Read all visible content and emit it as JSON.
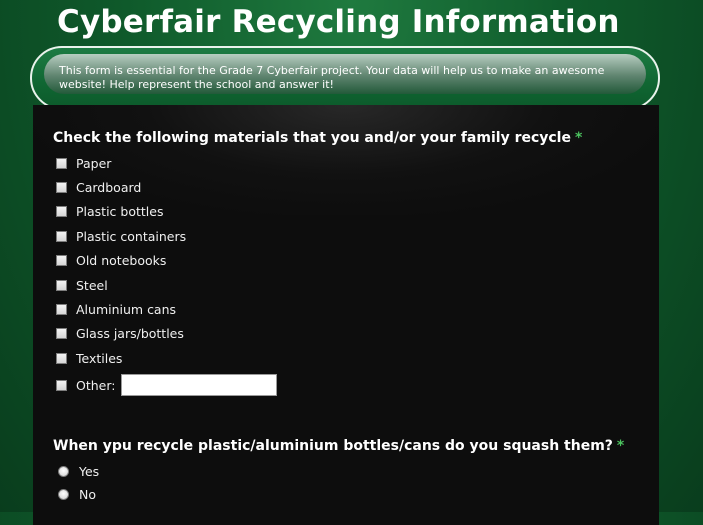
{
  "header": {
    "title": "Cyberfair Recycling Information",
    "description": "This form is essential for the Grade 7 Cyberfair project. Your data will help us to make an awesome website! Help represent the school and answer it!"
  },
  "question1": {
    "label": "Check the following materials that you and/or your family recycle",
    "required_mark": "*",
    "options": [
      "Paper",
      "Cardboard",
      "Plastic bottles",
      "Plastic containers",
      "Old notebooks",
      "Steel",
      "Aluminium cans",
      "Glass jars/bottles",
      "Textiles"
    ],
    "other_label": "Other:",
    "other_value": ""
  },
  "question2": {
    "label": "When ypu recycle plastic/aluminium bottles/cans do you squash them?",
    "required_mark": "*",
    "options": [
      "Yes",
      "No"
    ]
  },
  "colors": {
    "background_green": "#0f5a2b",
    "panel": "#0d0d0d",
    "required": "#4cc35f",
    "text": "#ffffff"
  }
}
